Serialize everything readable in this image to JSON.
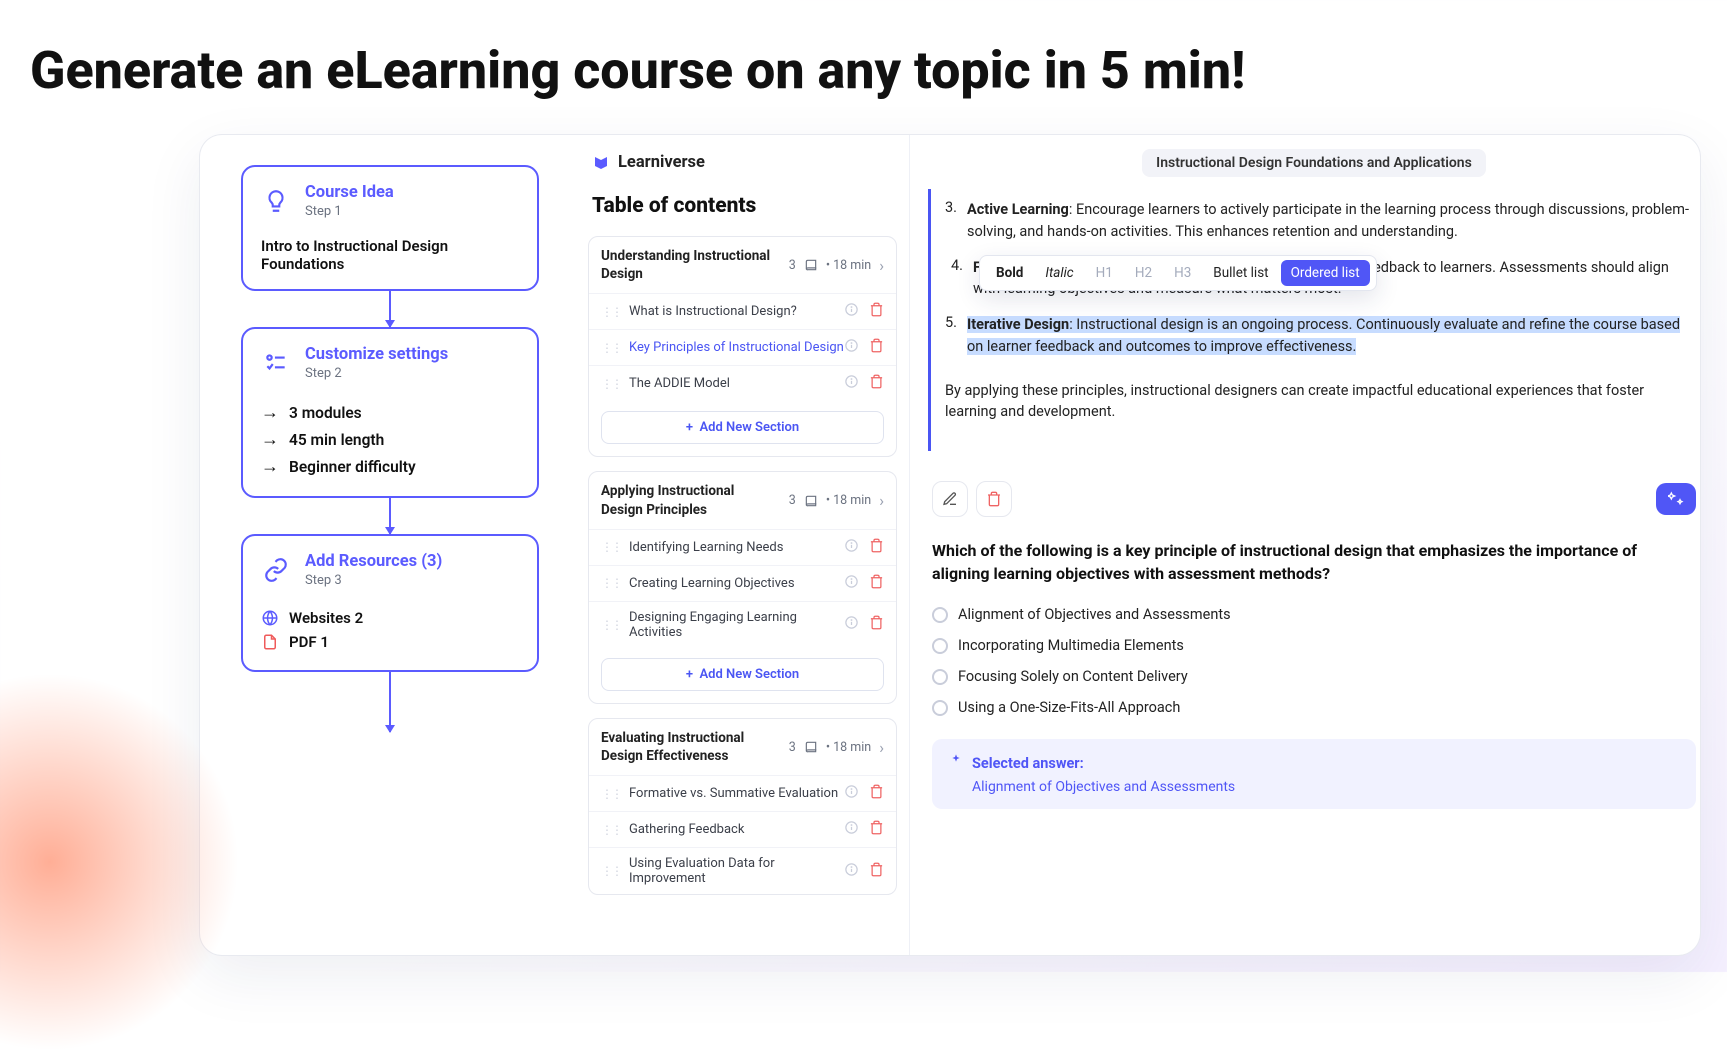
{
  "hero": {
    "title": "Generate an eLearning course on any topic in 5 min!"
  },
  "flow": {
    "card1": {
      "title": "Course Idea",
      "step": "Step 1",
      "body": "Intro to Instructional Design Foundations"
    },
    "card2": {
      "title": "Customize settings",
      "step": "Step 2",
      "lines": [
        "3 modules",
        "45 min length",
        "Beginner difficulty"
      ]
    },
    "card3": {
      "title": "Add Resources (3)",
      "step": "Step 3",
      "res": [
        "Websites 2",
        "PDF 1"
      ]
    }
  },
  "brand": {
    "name": "Learniverse"
  },
  "toc": {
    "heading": "Table of contents",
    "modules": [
      {
        "title": "Understanding Instructional Design",
        "meta": "3",
        "time": "18 min",
        "sections": [
          {
            "name": "What is Instructional Design?"
          },
          {
            "name": "Key Principles of Instructional Design",
            "hl": true
          },
          {
            "name": "The ADDIE Model"
          }
        ],
        "add_btn": "Add New Section"
      },
      {
        "title": "Applying Instructional Design Principles",
        "meta": "3",
        "time": "18 min",
        "sections": [
          {
            "name": "Identifying Learning Needs"
          },
          {
            "name": "Creating Learning Objectives"
          },
          {
            "name": "Designing Engaging Learning Activities"
          }
        ],
        "add_btn": "Add New Section"
      },
      {
        "title": "Evaluating Instructional Design Effectiveness",
        "meta": "3",
        "time": "18 min",
        "sections": [
          {
            "name": "Formative vs. Summative Evaluation"
          },
          {
            "name": "Gathering Feedback"
          },
          {
            "name": "Using Evaluation Data for Improvement"
          }
        ]
      }
    ]
  },
  "doc": {
    "title_pill": "Instructional Design Foundations and Applications",
    "item3_num": "3.",
    "item3_bold": "Active Learning",
    "item3_text": ": Encourage learners to actively participate in the learning process through discussions, problem-solving, and hands-on activities. This enhances retention and understanding.",
    "item4_num": "4.",
    "item4_bold": "Feedback and Assessment",
    "item4_text_a": ": Provide timely and constructive feedback to learners. Assessments should align",
    "item4_text_b": "with learning objectives and measure what matters most.",
    "item5_num": "5.",
    "item5_bold": "Iterative Design",
    "item5_text": ": Instructional design is an ongoing process. Continuously evaluate and refine the course based on learner feedback and outcomes to improve effectiveness.",
    "closing": "By applying these principles, instructional designers can create impactful educational experiences that foster learning and development.",
    "toolbar": {
      "bold": "Bold",
      "italic": "Italic",
      "h1": "H1",
      "h2": "H2",
      "h3": "H3",
      "bullet": "Bullet list",
      "ordered": "Ordered list"
    }
  },
  "quiz": {
    "question": "Which of the following is a key principle of instructional design that emphasizes the importance of aligning learning objectives with assessment methods?",
    "options": [
      "Alignment of Objectives and Assessments",
      "Incorporating Multimedia Elements",
      "Focusing Solely on Content Delivery",
      "Using a One-Size-Fits-All Approach"
    ],
    "ans_label": "Selected answer:",
    "ans_value": "Alignment of Objectives and Assessments"
  }
}
